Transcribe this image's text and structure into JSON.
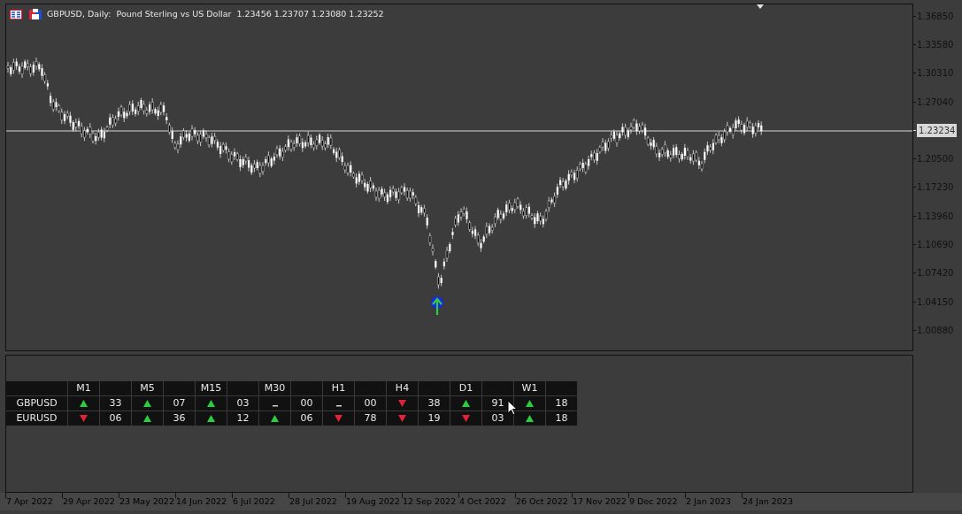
{
  "chart": {
    "title": "GBPUSD, Daily:  Pound Sterling vs US Dollar  1.23456 1.23707 1.23080 1.23252",
    "current_price": "1.23234"
  },
  "price_axis": [
    "1.36850",
    "1.33580",
    "1.30310",
    "1.27040",
    "1.20500",
    "1.17230",
    "1.13960",
    "1.10690",
    "1.07420",
    "1.04150",
    "1.00880"
  ],
  "date_axis": [
    "7 Apr 2022",
    "29 Apr 2022",
    "23 May 2022",
    "14 Jun 2022",
    "6 Jul 2022",
    "28 Jul 2022",
    "19 Aug 2022",
    "12 Sep 2022",
    "4 Oct 2022",
    "26 Oct 2022",
    "17 Nov 2022",
    "9 Dec 2022",
    "2 Jan 2023",
    "24 Jan 2023"
  ],
  "signal_table": {
    "timeframes": [
      "M1",
      "M5",
      "M15",
      "M30",
      "H1",
      "H4",
      "D1",
      "W1"
    ],
    "rows": [
      {
        "symbol": "GBPUSD",
        "signals": [
          {
            "kind": "up",
            "count": "33"
          },
          {
            "kind": "up",
            "count": "07"
          },
          {
            "kind": "up",
            "count": "03"
          },
          {
            "kind": "flat",
            "count": "00"
          },
          {
            "kind": "flat",
            "count": "00"
          },
          {
            "kind": "down",
            "count": "38"
          },
          {
            "kind": "up",
            "count": "91"
          },
          {
            "kind": "up",
            "count": "18"
          }
        ]
      },
      {
        "symbol": "EURUSD",
        "signals": [
          {
            "kind": "down",
            "count": "06"
          },
          {
            "kind": "up",
            "count": "36"
          },
          {
            "kind": "up",
            "count": "12"
          },
          {
            "kind": "up",
            "count": "06"
          },
          {
            "kind": "down",
            "count": "78"
          },
          {
            "kind": "down",
            "count": "19"
          },
          {
            "kind": "down",
            "count": "03"
          },
          {
            "kind": "up",
            "count": "18"
          }
        ]
      }
    ]
  }
}
